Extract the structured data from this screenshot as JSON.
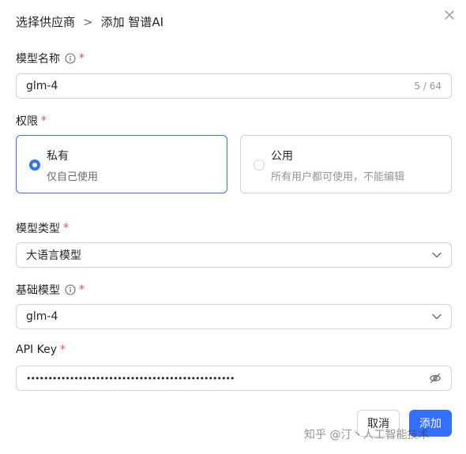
{
  "header": {
    "breadcrumb_parent": "选择供应商",
    "separator": ">",
    "title": "添加 智谱AI"
  },
  "close_icon": "close-icon",
  "form": {
    "model_name": {
      "label": "模型名称",
      "required_mark": "*",
      "value": "glm-4",
      "count": "5 / 64"
    },
    "permission": {
      "label": "权限",
      "required_mark": "*",
      "options": [
        {
          "title": "私有",
          "desc": "仅自己使用",
          "selected": true
        },
        {
          "title": "公用",
          "desc": "所有用户都可使用，不能编辑",
          "selected": false
        }
      ]
    },
    "model_type": {
      "label": "模型类型",
      "required_mark": "*",
      "value": "大语言模型"
    },
    "base_model": {
      "label": "基础模型",
      "required_mark": "*",
      "value": "glm-4"
    },
    "api_key": {
      "label": "API Key",
      "required_mark": "*",
      "value": "••••••••••••••••••••••••••••••••••••••••••••••••"
    }
  },
  "buttons": {
    "cancel": "取消",
    "submit": "添加"
  },
  "watermark": "知乎 @汀丶人工智能技术",
  "colors": {
    "primary": "#3370ff",
    "required": "#f54a45",
    "border": "#d0d3d6"
  }
}
